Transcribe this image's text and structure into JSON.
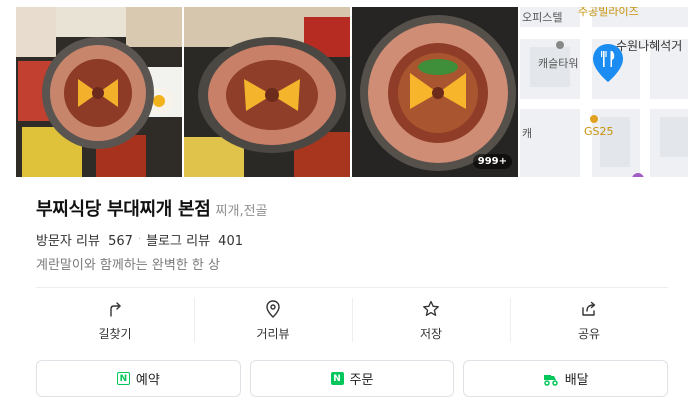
{
  "photos": {
    "count_badge": "999+"
  },
  "map": {
    "labels": [
      "오피스텔",
      "주공빌라이즈",
      "캐슬타워",
      "수원나혜석거",
      "GS25",
      "캐"
    ],
    "pin_icon": "fork-knife-icon",
    "accent": "#1b8df2"
  },
  "place": {
    "name": "부찌식당 부대찌개 본점",
    "category": "찌개,전골",
    "visitor_review_label": "방문자 리뷰",
    "visitor_review_count": "567",
    "blog_review_label": "블로그 리뷰",
    "blog_review_count": "401",
    "description": "계란말이와 함께하는 완벽한 한 상"
  },
  "actions": [
    {
      "label": "길찾기",
      "icon": "directions-icon"
    },
    {
      "label": "거리뷰",
      "icon": "location-pin-icon"
    },
    {
      "label": "저장",
      "icon": "star-icon"
    },
    {
      "label": "공유",
      "icon": "share-icon"
    }
  ],
  "buttons": {
    "reserve": "예약",
    "order": "주문",
    "delivery": "배달"
  },
  "colors": {
    "naver_green": "#03c75a",
    "pin_blue": "#1b8df2"
  }
}
